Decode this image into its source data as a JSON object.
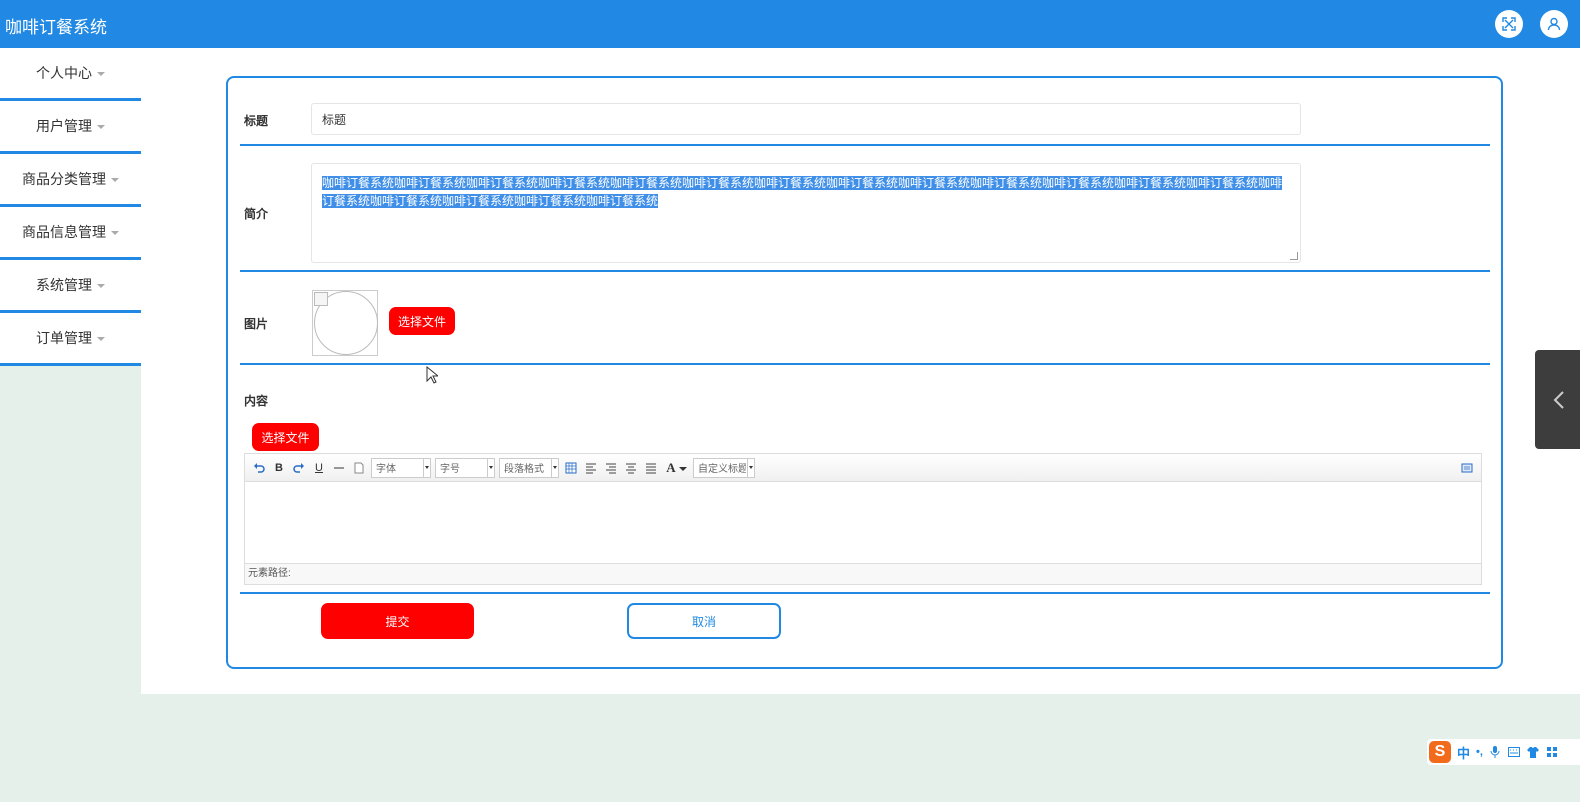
{
  "app": {
    "title": "咖啡订餐系统"
  },
  "header": {
    "fullscreen_icon": "fullscreen-icon",
    "user_icon": "user-icon"
  },
  "sidebar": {
    "items": [
      {
        "label": "个人中心"
      },
      {
        "label": "用户管理"
      },
      {
        "label": "商品分类管理"
      },
      {
        "label": "商品信息管理"
      },
      {
        "label": "系统管理"
      },
      {
        "label": "订单管理"
      }
    ]
  },
  "form": {
    "title_label": "标题",
    "title_value": "标题",
    "intro_label": "简介",
    "intro_value": "咖啡订餐系统咖啡订餐系统咖啡订餐系统咖啡订餐系统咖啡订餐系统咖啡订餐系统咖啡订餐系统咖啡订餐系统咖啡订餐系统咖啡订餐系统咖啡订餐系统咖啡订餐系统咖啡订餐系统咖啡订餐系统咖啡订餐系统咖啡订餐系统咖啡订餐系统咖啡订餐系统",
    "image_label": "图片",
    "choose_file_label": "选择文件",
    "content_label": "内容",
    "content_choose_file_label": "选择文件",
    "submit_label": "提交",
    "cancel_label": "取消"
  },
  "editor": {
    "font_family": "字体",
    "font_size": "字号",
    "paragraph_format": "段落格式",
    "custom_title": "自定义标题",
    "bold": "B",
    "underline": "U",
    "font_color": "A",
    "element_path": "元素路径:"
  },
  "ime": {
    "logo": "S",
    "mode": "中",
    "punct": "•,"
  },
  "colors": {
    "primary": "#2189e3",
    "danger": "#ff0000",
    "background": "#e6f0eb"
  }
}
